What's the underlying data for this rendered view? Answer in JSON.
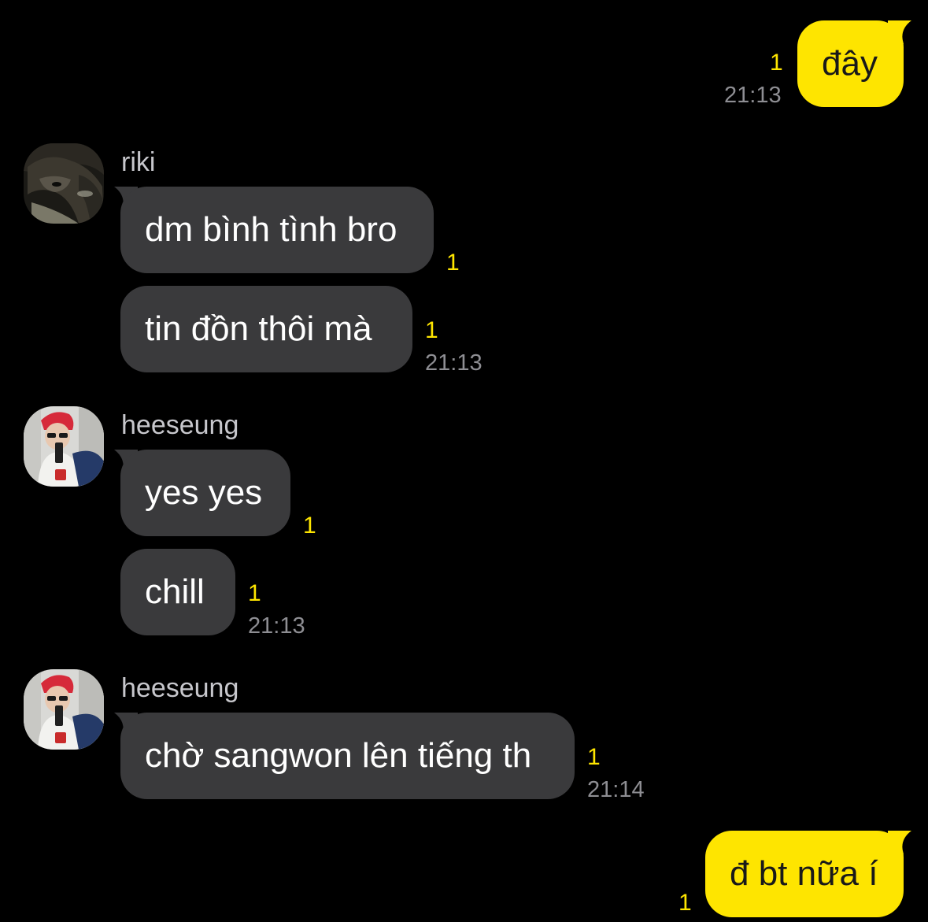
{
  "messages": [
    {
      "direction": "out",
      "text": "đây",
      "unread": "1",
      "time": "21:13"
    },
    {
      "direction": "in",
      "sender": "riki",
      "text": "dm bình tình bro",
      "unread": "1"
    },
    {
      "direction": "in",
      "sender": "riki",
      "text": "tin đồn thôi mà",
      "unread": "1",
      "time": "21:13"
    },
    {
      "direction": "in",
      "sender": "heeseung",
      "text": "yes yes",
      "unread": "1"
    },
    {
      "direction": "in",
      "sender": "heeseung",
      "text": "chill",
      "unread": "1",
      "time": "21:13"
    },
    {
      "direction": "in",
      "sender": "heeseung",
      "text": "chờ sangwon lên tiếng th",
      "unread": "1",
      "time": "21:14"
    },
    {
      "direction": "out",
      "text": "đ bt nữa í",
      "unread": "1"
    }
  ],
  "avatars": {
    "riki": "riki-avatar",
    "heeseung": "heeseung-avatar"
  },
  "colors": {
    "background": "#000000",
    "outgoing_bubble": "#fee500",
    "incoming_bubble": "#3a3a3c",
    "unread_count": "#fee500",
    "timestamp": "#8e8e93"
  }
}
